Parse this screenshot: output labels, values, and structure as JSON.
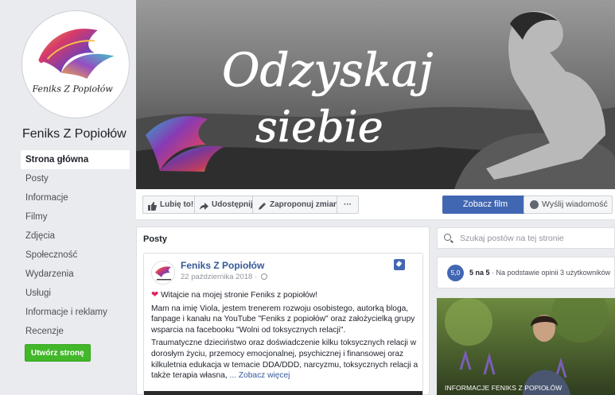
{
  "sidebar": {
    "avatar_text": "Feniks Z Popiołów",
    "page_name": "Feniks Z Popiołów",
    "nav": [
      {
        "label": "Strona główna",
        "active": true
      },
      {
        "label": "Posty"
      },
      {
        "label": "Informacje"
      },
      {
        "label": "Filmy"
      },
      {
        "label": "Zdjęcia"
      },
      {
        "label": "Społeczność"
      },
      {
        "label": "Wydarzenia"
      },
      {
        "label": "Usługi"
      },
      {
        "label": "Informacje i reklamy"
      },
      {
        "label": "Recenzje"
      }
    ],
    "create_page_label": "Utwórz stronę"
  },
  "cover": {
    "line1": "Odzyskaj",
    "line2": "siebie"
  },
  "actions": {
    "like": "Lubię to!",
    "share": "Udostępnij",
    "suggest": "Zaproponuj zmiany",
    "more": "···",
    "watch": "Zobacz film",
    "message": "Wyślij wiadomość"
  },
  "posts": {
    "title": "Posty",
    "author": "Feniks Z Popiołów",
    "date": "22 października 2018 ·",
    "paragraphs": [
      "Witajcie na mojej stronie Feniks z popiołów!",
      "Mam na imię Viola, jestem trenerem rozwoju osobistego, autorką bloga, fanpage i kanału na YouTube \"Feniks z popiołów\" oraz założycielką grupy wsparcia na facebooku \"Wolni od toksycznych relacji\".",
      "Traumatyczne dzieciństwo oraz doświadczenie kilku toksycznych relacji w dorosłym życiu, przemocy emocjonalnej, psychicznej i finansowej oraz kilkuletnia edukacja w temacie DDA/DDD, narcyzmu, toksycznych relacji a także terapia własna,"
    ],
    "see_more": "... Zobacz więcej"
  },
  "right": {
    "search_placeholder": "Szukaj postów na tej stronie",
    "rating_score": "5,0",
    "rating_bold": "5 na 5",
    "rating_text": " · Na podstawie opinii 3 użytkowników",
    "info_label": "INFORMACJE FENIKS Z POPIOŁÓW"
  },
  "colors": {
    "brand_blue": "#4267b2",
    "link_blue": "#365899",
    "green": "#42b72a",
    "bg": "#e9ebee"
  }
}
